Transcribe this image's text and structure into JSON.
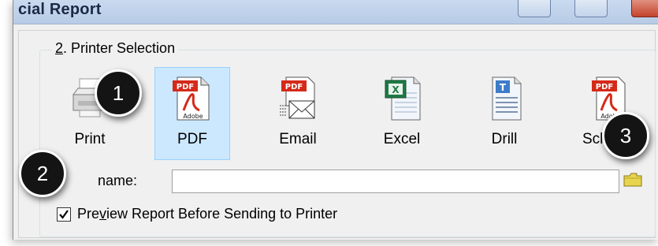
{
  "window": {
    "title": "cial Report"
  },
  "group": {
    "label_number": "2",
    "label_rest": ". Printer Selection"
  },
  "printer_options": [
    {
      "label": "Print"
    },
    {
      "label": "PDF",
      "selected": true
    },
    {
      "label": "Email"
    },
    {
      "label": "Excel"
    },
    {
      "label": "Drill"
    },
    {
      "label": "Sche"
    }
  ],
  "file_name": {
    "label": "name:",
    "value": ""
  },
  "preview_checkbox": {
    "checked": true,
    "label_pre": "Pre",
    "label_underlined": "v",
    "label_post": "iew Report Before Sending to Printer"
  },
  "callouts": [
    "1",
    "2",
    "3"
  ],
  "icons": {
    "pdf_badge": "PDF",
    "adobe_text": "Adobe",
    "excel_mark": "X",
    "word_mark": "T"
  },
  "colors": {
    "selected_bg": "#cce8ff",
    "pdf_red": "#d42a1a",
    "callout_bg": "#141414"
  }
}
